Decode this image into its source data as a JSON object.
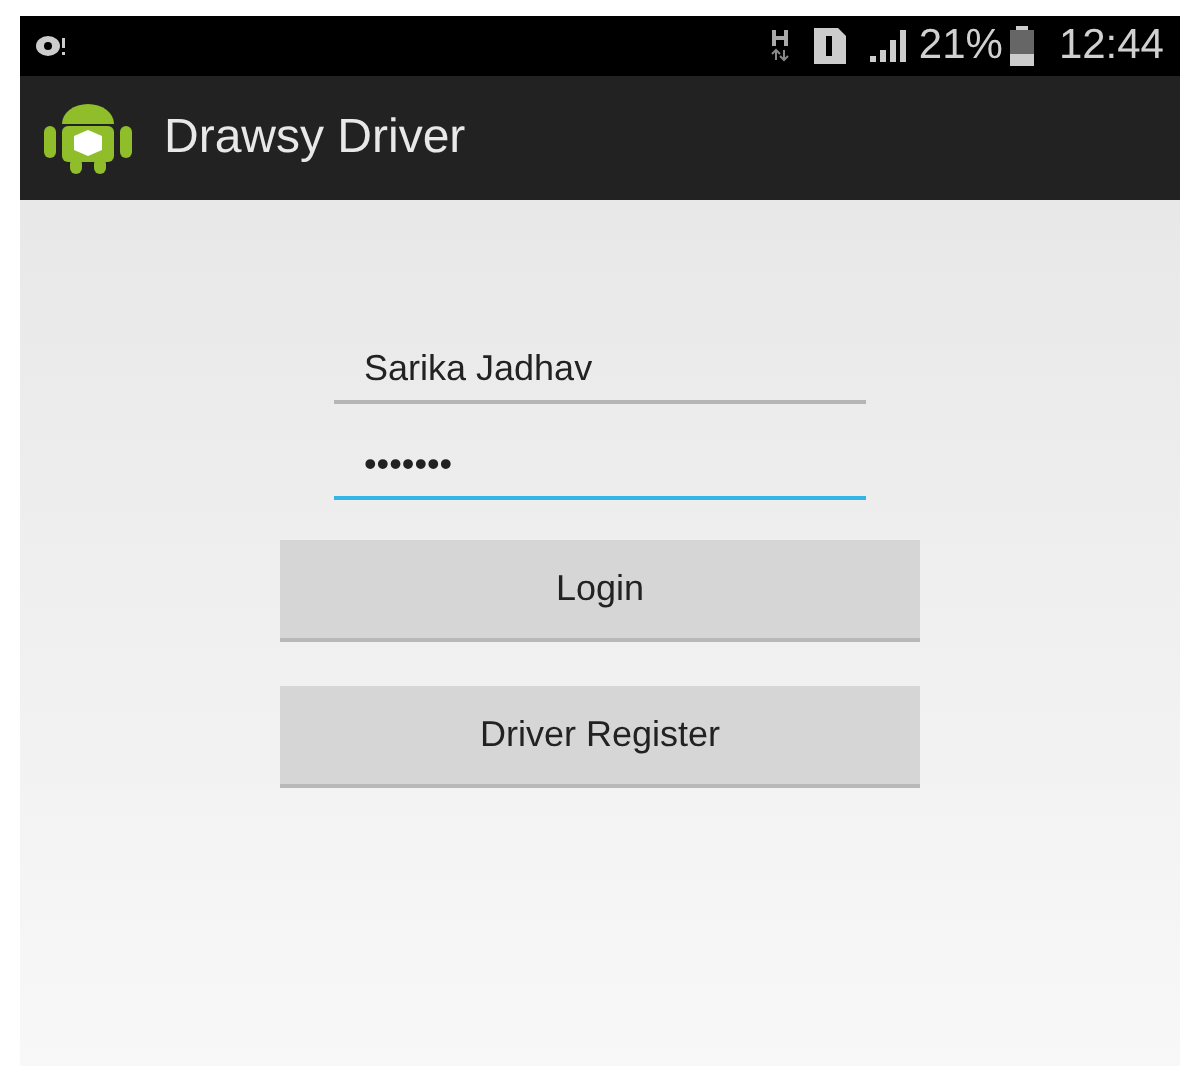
{
  "status_bar": {
    "battery": "21%",
    "time": "12:44"
  },
  "app_bar": {
    "title": "Drawsy Driver"
  },
  "fields": [
    {
      "value": "Sarika Jadhav",
      "focused": false
    },
    {
      "value": "•••••••",
      "focused": true
    }
  ],
  "buttons": [
    "Login",
    "Driver Register"
  ]
}
